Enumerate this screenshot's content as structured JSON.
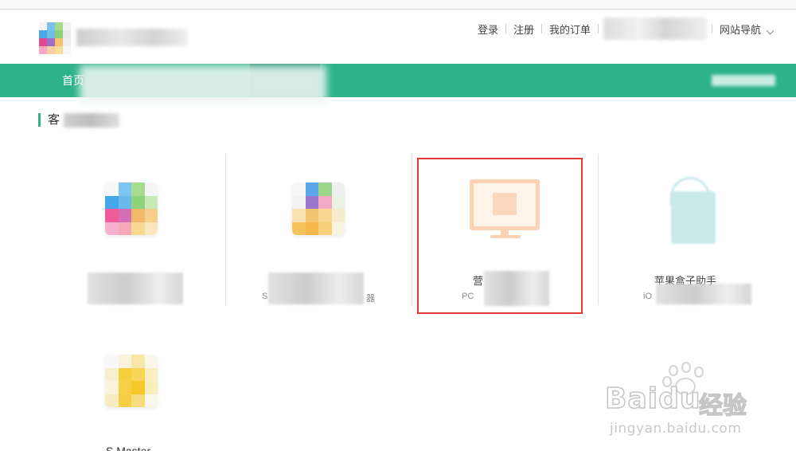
{
  "header": {
    "nav_links": [
      "登录",
      "注册",
      "我的订单"
    ],
    "site_nav_label": "网站导航"
  },
  "main_nav": {
    "items": [
      {
        "label": "首页"
      }
    ]
  },
  "section": {
    "title_visible": "客"
  },
  "products": [
    {
      "name": "",
      "sub": ""
    },
    {
      "name": "",
      "sub": "S",
      "sub_tail": "器",
      "name_tail": "端"
    },
    {
      "name": "营",
      "sub": "PC"
    },
    {
      "name": "苹果盒子助手",
      "sub": "iO"
    }
  ],
  "bottom_product": {
    "name": "S Master"
  },
  "watermark": {
    "brand": "Bai",
    "brand_du": "du",
    "brand_cn": "经验",
    "url": "jingyan.baidu.com"
  },
  "colors": {
    "nav_green": "#2db28a",
    "nav_active": "#178a69",
    "highlight_red": "#e53935"
  }
}
